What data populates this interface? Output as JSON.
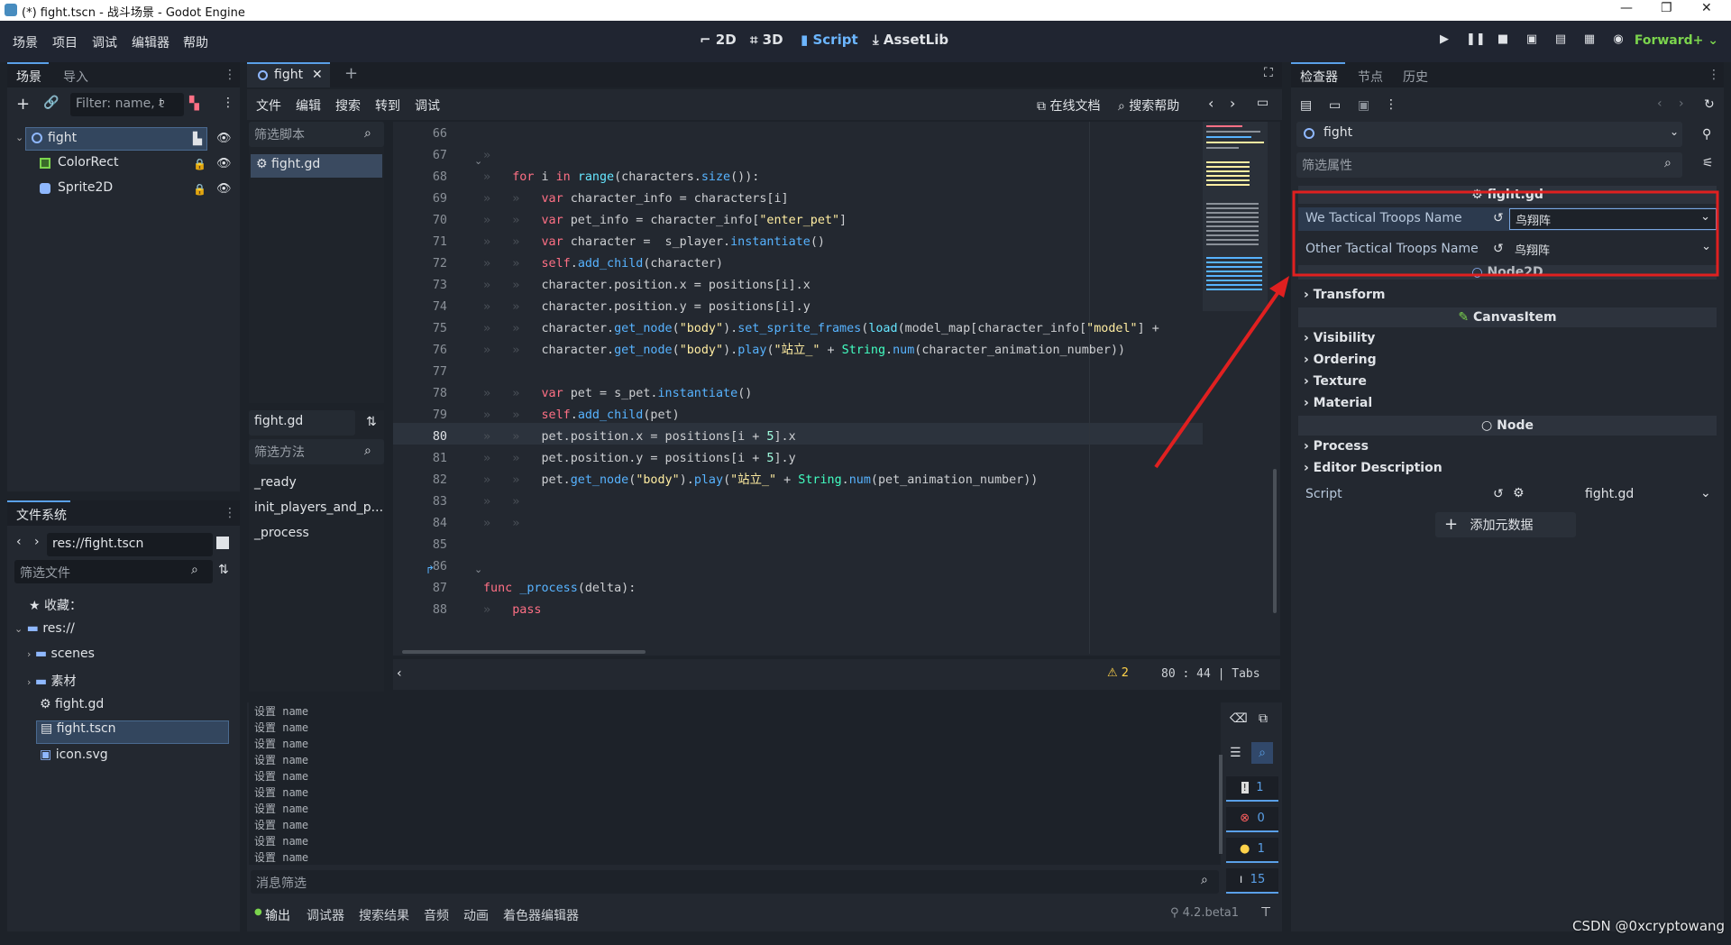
{
  "window": {
    "title": "(*) fight.tscn - 战斗场景 - Godot Engine"
  },
  "menu": [
    "场景",
    "项目",
    "调试",
    "编辑器",
    "帮助"
  ],
  "workspaces": [
    "2D",
    "3D",
    "Script",
    "AssetLib"
  ],
  "renderer": "Forward+",
  "scene_dock": {
    "tabs": [
      "场景",
      "导入"
    ],
    "filter_placeholder": "Filter: name, t",
    "nodes": [
      "fight",
      "ColorRect",
      "Sprite2D"
    ]
  },
  "fs_dock": {
    "title": "文件系统",
    "path": "res://fight.tscn",
    "filter": "筛选文件",
    "favorites": "收藏：",
    "items": [
      "res://",
      "scenes",
      "素材",
      "fight.gd",
      "fight.tscn",
      "icon.svg"
    ]
  },
  "editor": {
    "tab": "fight",
    "script_menu": [
      "文件",
      "编辑",
      "搜索",
      "转到",
      "调试"
    ],
    "online_docs": "在线文档",
    "search_help": "搜索帮助",
    "filter_scripts": "筛选脚本",
    "script_item": "fight.gd",
    "current_script": "fight.gd",
    "filter_methods": "筛选方法",
    "methods": [
      "_ready",
      "init_players_and_p...",
      "_process"
    ],
    "line_numbers": [
      "66",
      "67",
      "68",
      "69",
      "70",
      "71",
      "72",
      "73",
      "74",
      "75",
      "76",
      "77",
      "78",
      "79",
      "80",
      "81",
      "82",
      "83",
      "84",
      "85",
      "86",
      "87",
      "88"
    ],
    "status": {
      "warnings": "2",
      "pos": "80 :  44 | Tabs"
    }
  },
  "output": {
    "lines": [
      "设置 name",
      "设置 name",
      "设置 name",
      "设置 name",
      "设置 name",
      "设置 name",
      "设置 name",
      "设置 name",
      "设置 name",
      "设置 name"
    ],
    "filter": "消息筛选",
    "counts": [
      "1",
      "0",
      "1",
      "15"
    ],
    "bottom_tabs": [
      "输出",
      "调试器",
      "搜索结果",
      "音频",
      "动画",
      "着色器编辑器"
    ],
    "version": "4.2.beta1"
  },
  "inspector": {
    "tabs": [
      "检查器",
      "节点",
      "历史"
    ],
    "node": "fight",
    "filter": "筛选属性",
    "script_header": "fight.gd",
    "props": [
      {
        "label": "We Tactical Troops Name",
        "value": "鸟翔阵"
      },
      {
        "label": "Other Tactical Troops Name",
        "value": "鸟翔阵"
      }
    ],
    "node2d": "Node2D",
    "transform": "Transform",
    "canvas_item": "CanvasItem",
    "canvas_cats": [
      "Visibility",
      "Ordering",
      "Texture",
      "Material"
    ],
    "node_hdr": "Node",
    "node_cats": [
      "Process",
      "Editor Description"
    ],
    "script_label": "Script",
    "script_value": "fight.gd",
    "add_meta": "添加元数据"
  },
  "watermark": "CSDN @0xcryptowang",
  "colors": {
    "accent": "#5aa0e8",
    "highlight": "#e02020"
  }
}
